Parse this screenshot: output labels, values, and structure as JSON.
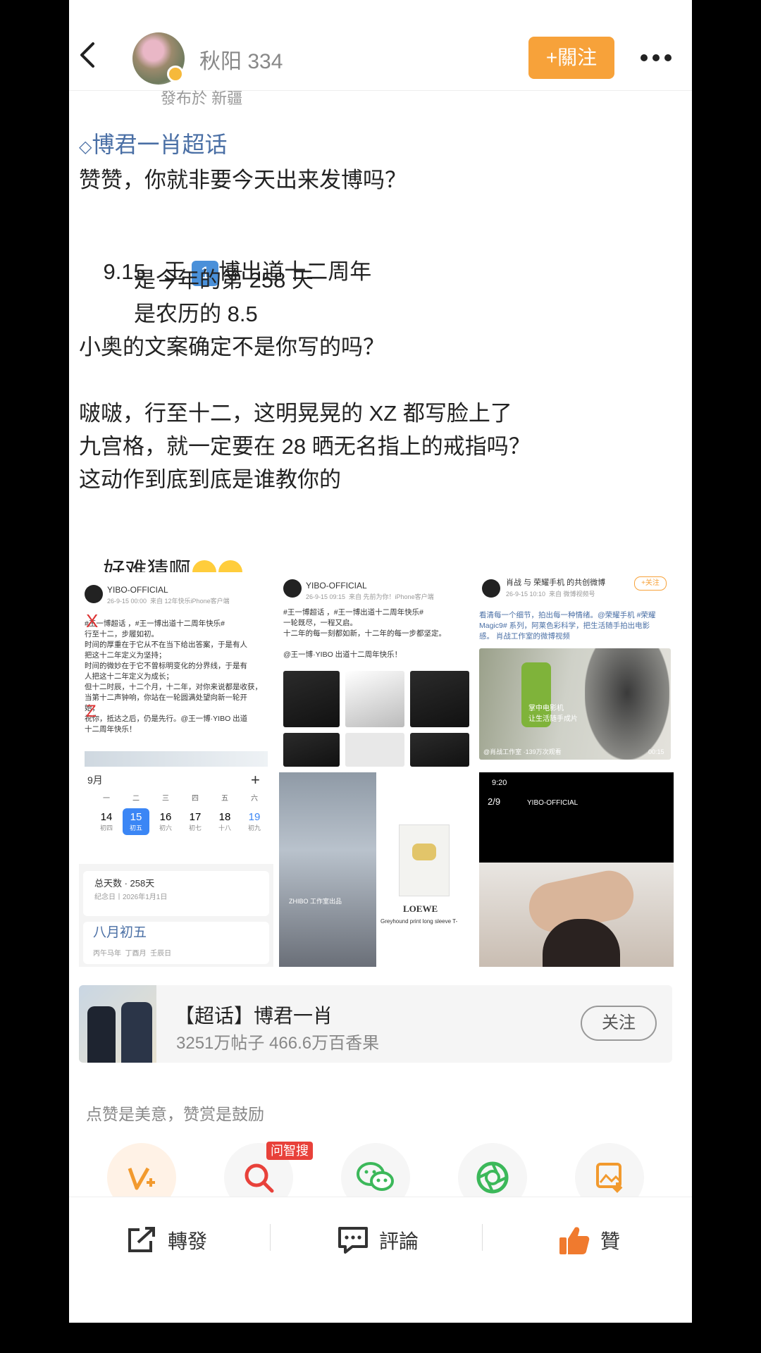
{
  "header": {
    "username": "秋阳 334",
    "follow_label": "+關注",
    "location": "發布於 新疆"
  },
  "post": {
    "topic": "博君一肖超话",
    "line1": "赞赞，你就非要今天出来发博吗？",
    "line2_pre": "9.15   王 ",
    "line2_emoji": "1",
    "line2_post": "博出道十二周年",
    "line3": "是今年的第 258 天",
    "line4": "是农历的 8.5",
    "line5": "小奥的文案确定不是你写的吗？",
    "line6": "啵啵，行至十二，这明晃晃的 XZ 都写脸上了",
    "line7": "九宫格，就一定要在 28 晒无名指上的戒指吗？",
    "line8": "这动作到底到底是谁教你的",
    "line9": "好难猜啊"
  },
  "images": {
    "img1": {
      "account": "YIBO-OFFICIAL",
      "meta": "26-9-15 00:00  来自 12年快乐iPhone客户端",
      "body": "#王一博超话 ，#王一博出道十二周年快乐#\n行至十二，步履如初。\n时间的厚重在于它从不在当下给出答案，于是有人\n把这十二年定义为坚持；\n时间的微妙在于它不曾标明变化的分界线，于是有\n人把这十二年定义为成长；\n但十二时辰，十二个月，十二年，对你来说都是收获，\n当第十二声钟响，你站在一轮圆满处望向新一轮开\n始，\n祝你，抵达之后，仍是先行。@王一博·YIBO 出道\n十二周年快乐！"
    },
    "img2": {
      "account": "YIBO-OFFICIAL",
      "meta": "26-9-15 09:15  来自 先前为你！iPhone客户端",
      "body": "#王一博超话 ，#王一博出道十二周年快乐#\n一轮既尽，一程又启。\n十二年的每一刻都如新，十二年的每一步都坚定。\n\n@王一博·YIBO 出道十二周年快乐！"
    },
    "img3": {
      "account": "肖战 与 荣耀手机 的共创微博",
      "meta": "26-9-15 10:10  来自 微博视频号",
      "body": "看清每一个细节，拍出每一种情绪。@荣耀手机 #荣耀\nMagic9# 系列，阿莱色彩科学，把生活随手拍出电影\n感。 肖战工作室的微博视频",
      "video_caption": "掌中电影机\n让生活随手成片",
      "views": "@肖战工作室 ·139万次观看",
      "duration": "00:15",
      "follow": "+关注"
    },
    "img4": {
      "month": "9月",
      "weekdays": [
        "一",
        "二",
        "三",
        "四",
        "五",
        "六"
      ],
      "dates": [
        "14",
        "15",
        "16",
        "17",
        "18",
        "19"
      ],
      "lunar": [
        "初四",
        "初五",
        "初六",
        "初七",
        "十八",
        "初九"
      ],
      "total_label": "总天数 · 258天",
      "anniv": "纪念日丨2026年1月1日",
      "lunar_date": "八月初五",
      "ganzhi": "丙午马年  丁酉月  壬辰日"
    },
    "img5": {
      "caption": "ZHIBO 工作室出品",
      "brand": "LOEWE",
      "brand_sub": "Greyhound print long sleeve T-"
    },
    "img6": {
      "time": "9:20",
      "page": "2/9",
      "account": "YIBO-OFFICIAL"
    }
  },
  "topic_card": {
    "title": "【超话】博君一肖",
    "stats": "3251万帖子 466.6万百香果",
    "follow_label": "关注"
  },
  "reward_text": "点赞是美意，赞赏是鼓励",
  "ask_badge": "问智搜",
  "bottom_bar": {
    "repost": "轉發",
    "comment": "評論",
    "like": "贊"
  }
}
